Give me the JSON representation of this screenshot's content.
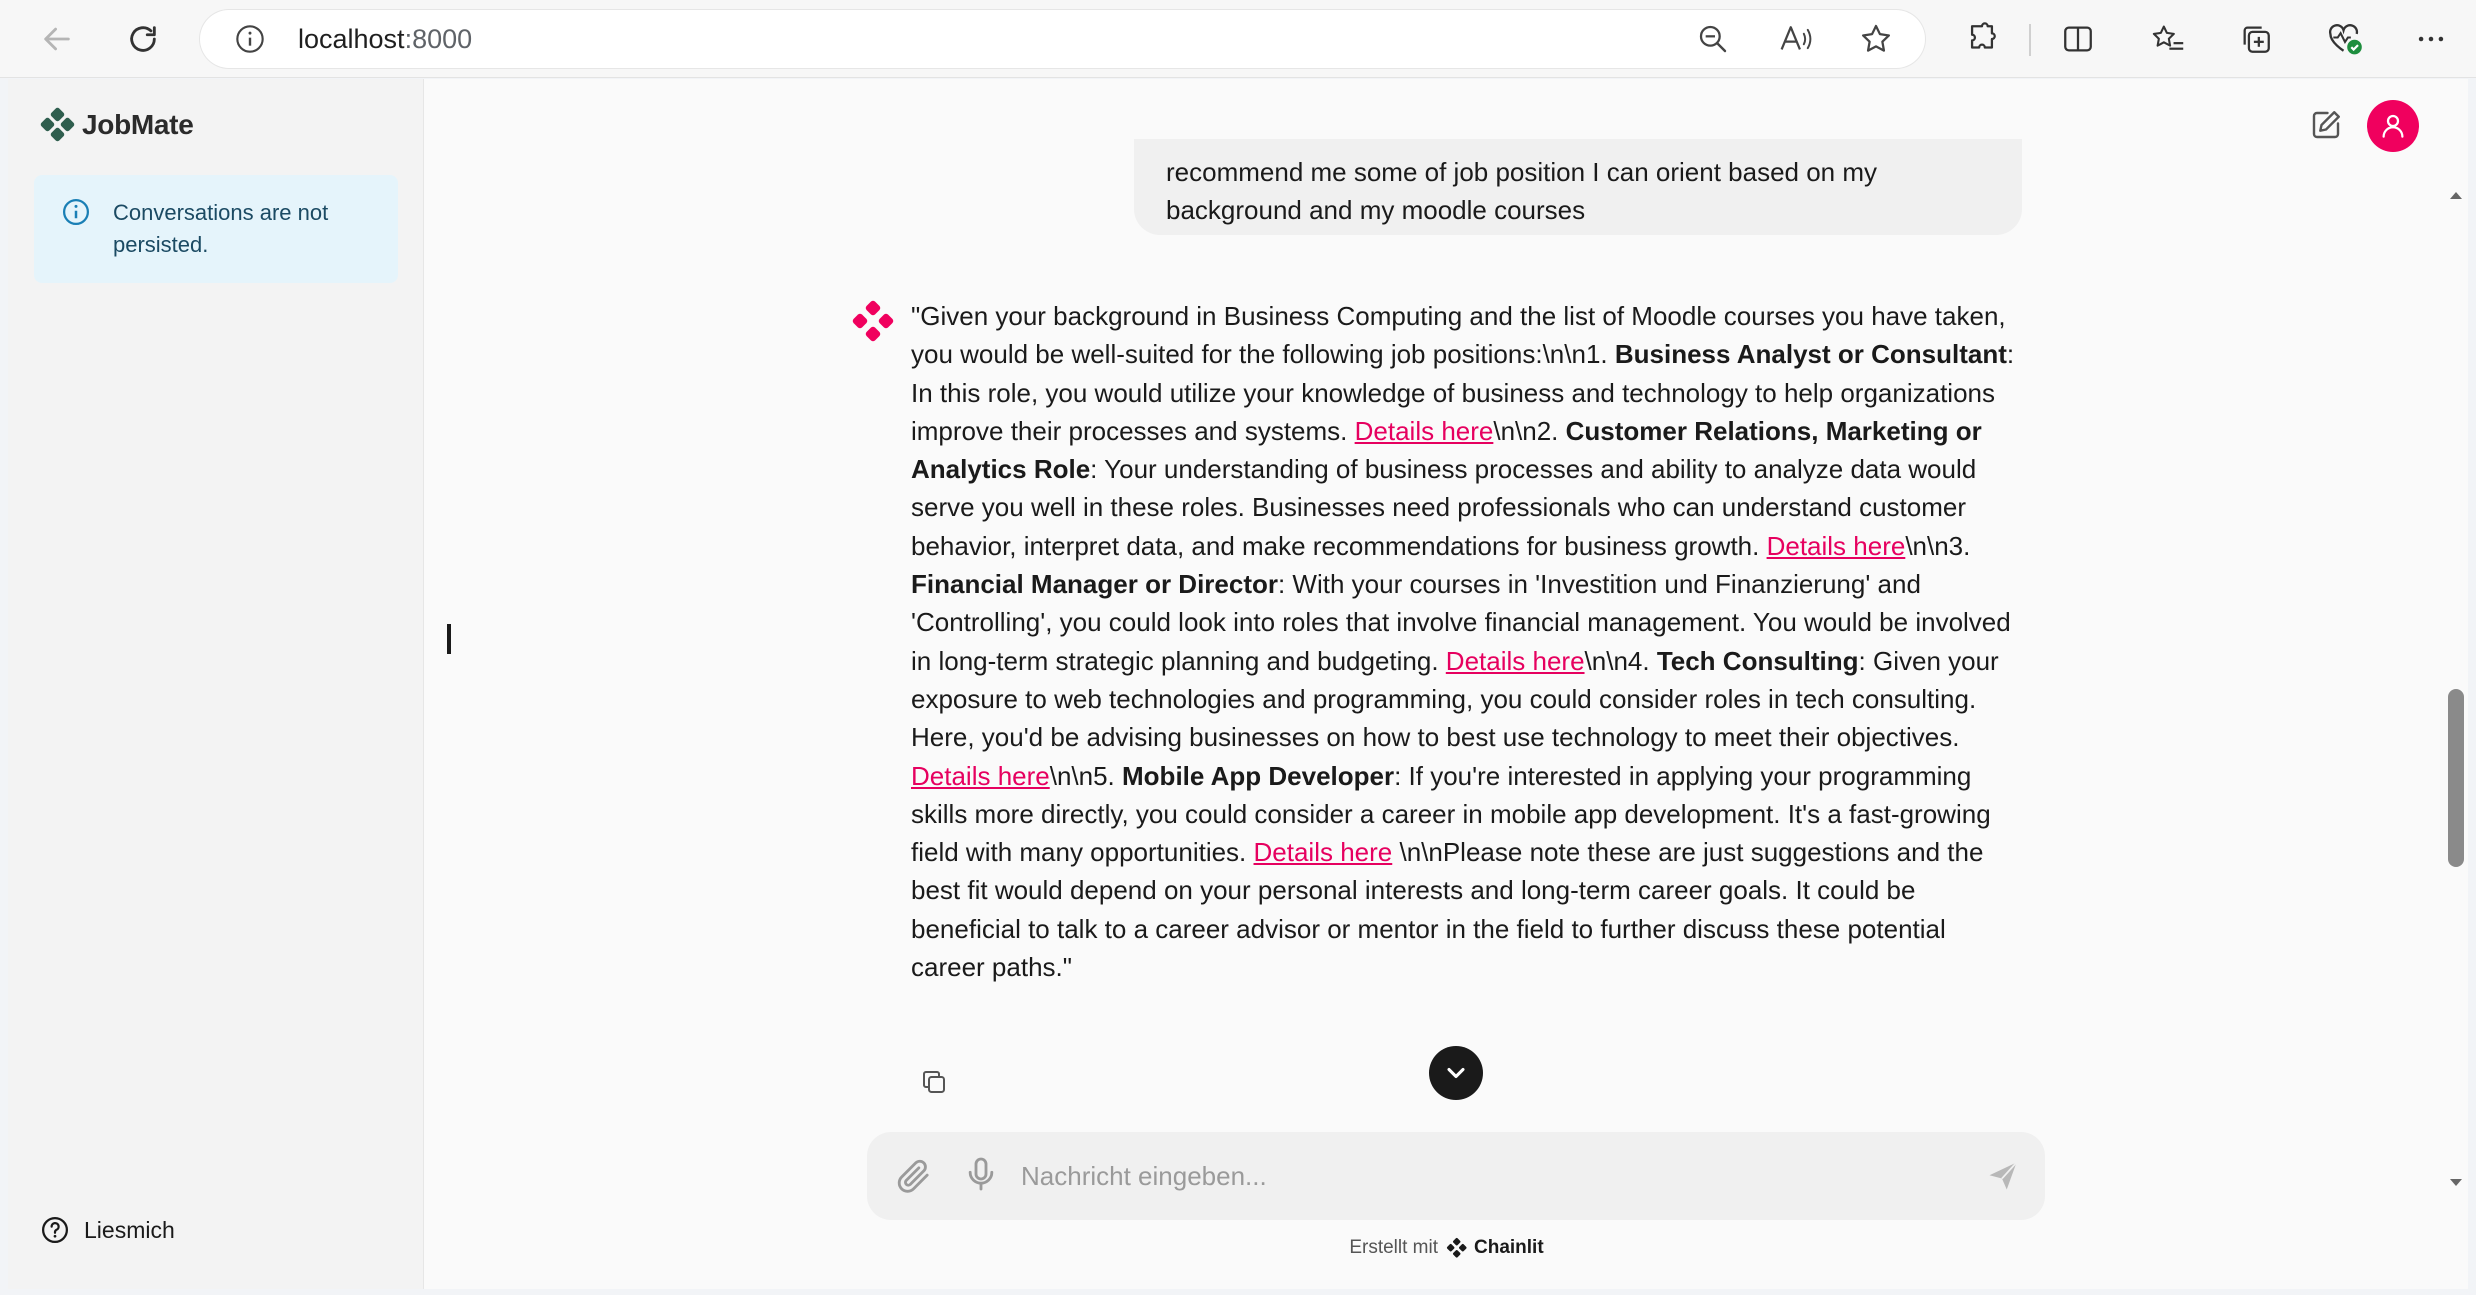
{
  "browser": {
    "url_host": "localhost",
    "url_port": ":8000"
  },
  "sidebar": {
    "app_name": "JobMate",
    "notice": "Conversations are not persisted.",
    "readme_label": "Liesmich"
  },
  "chat": {
    "user_message": "recommend me some of job position I can orient based on my background and my moodle courses",
    "bot_message": {
      "intro": "\"Given your background in Business Computing and the list of Moodle courses you have taken, you would be well-suited for the following job positions:\\n\\n1. ",
      "items": [
        {
          "title": "Business Analyst or Consultant",
          "text": ": In this role, you would utilize your knowledge of business and technology to help organizations improve their processes and systems. ",
          "link": "Details here",
          "after": "\\n\\n2. "
        },
        {
          "title": "Customer Relations, Marketing or Analytics Role",
          "text": ": Your understanding of business processes and ability to analyze data would serve you well in these roles. Businesses need professionals who can understand customer behavior, interpret data, and make recommendations for business growth. ",
          "link": "Details here",
          "after": "\\n\\n3. "
        },
        {
          "title": "Financial Manager or Director",
          "text": ": With your courses in 'Investition und Finanzierung' and 'Controlling', you could look into roles that involve financial management. You would be involved in long-term strategic planning and budgeting. ",
          "link": "Details here",
          "after": "\\n\\n4. "
        },
        {
          "title": "Tech Consulting",
          "text": ": Given your exposure to web technologies and programming, you could consider roles in tech consulting. Here, you'd be advising businesses on how to best use technology to meet their objectives. ",
          "link": "Details here",
          "after": "\\n\\n5. "
        },
        {
          "title": "Mobile App Developer",
          "text": ": If you're interested in applying your programming skills more directly, you could consider a career in mobile app development. It's a fast-growing field with many opportunities. ",
          "link": "Details here",
          "after": " \\n\\nPlease note these are just suggestions and the best fit would depend on your personal interests and long-term career goals. It could be beneficial to talk to a career advisor or mentor in the field to further discuss these potential career paths.\""
        }
      ]
    }
  },
  "composer": {
    "placeholder": "Nachricht eingeben..."
  },
  "footer": {
    "prefix": "Erstellt mit",
    "brand": "Chainlit"
  },
  "colors": {
    "accent": "#f0005e",
    "link": "#e6005f",
    "info_bg": "#e5f4fb"
  }
}
